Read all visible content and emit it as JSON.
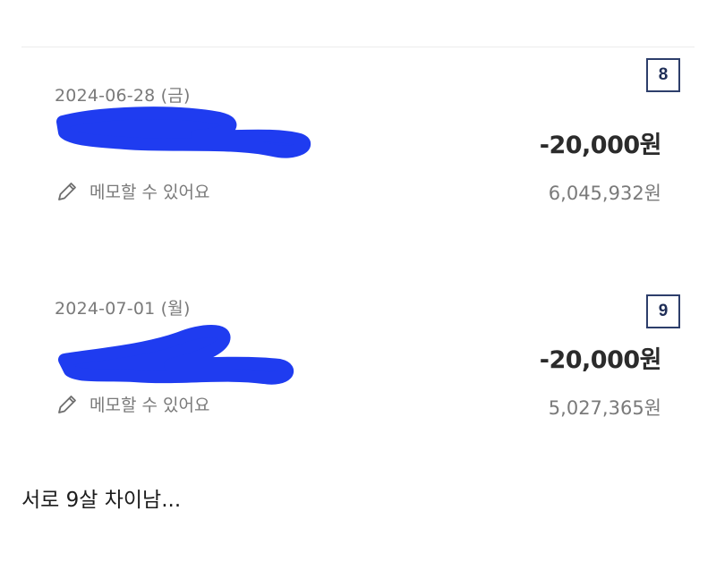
{
  "transactions": [
    {
      "index": "8",
      "date": "2024-06-28 (금)",
      "amount": "-20,000원",
      "memo_placeholder": "메모할 수 있어요",
      "balance": "6,045,932원"
    },
    {
      "index": "9",
      "date": "2024-07-01 (월)",
      "amount": "-20,000원",
      "memo_placeholder": "메모할 수 있어요",
      "balance": "5,027,365원"
    }
  ],
  "caption": "서로 9살 차이남...",
  "colors": {
    "redaction": "#1f3cf0",
    "badge_border": "#2d3e6b",
    "muted_text": "#7a7a7a",
    "amount_text": "#2b2b2b"
  },
  "icons": {
    "memo": "pencil-icon"
  }
}
